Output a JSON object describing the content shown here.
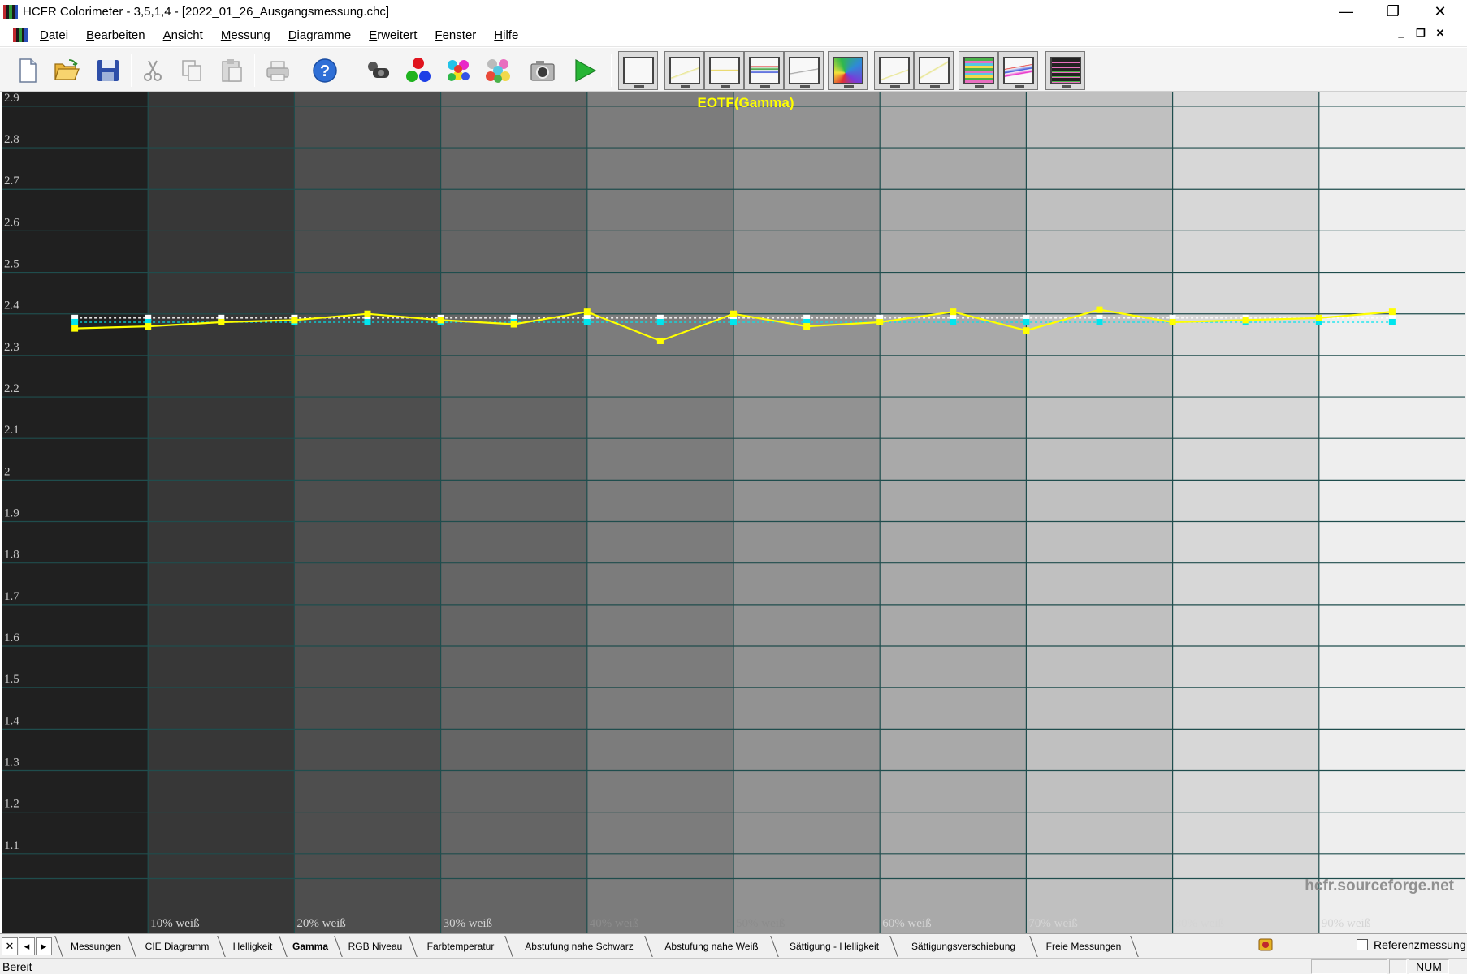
{
  "window": {
    "title": "HCFR Colorimeter - 3,5,1,4 - [2022_01_26_Ausgangsmessung.chc]",
    "minimize_glyph": "—",
    "maximize_glyph": "❐",
    "close_glyph": "✕"
  },
  "menu": {
    "items": [
      "Datei",
      "Bearbeiten",
      "Ansicht",
      "Messung",
      "Diagramme",
      "Erweitert",
      "Fenster",
      "Hilfe"
    ],
    "mdi_minimize": "_",
    "mdi_restore": "❐",
    "mdi_close": "✕"
  },
  "toolbar": {
    "icons": [
      "new-file-icon",
      "open-folder-icon",
      "save-icon",
      "cut-icon",
      "copy-icon",
      "paste-icon",
      "print-icon",
      "help-icon",
      "colorimeter-sensor-icon",
      "rgb-primaries-icon",
      "secondary-colors-icon",
      "all-colors-icon",
      "camera-icon",
      "play-icon"
    ],
    "graph_buttons": [
      "luminance-graph-icon",
      "gamma-graph-icon",
      "rgb-levels-graph-icon",
      "rgb-histogram-graph-icon",
      "color-temp-graph-icon",
      "cie-chart-icon",
      "near-black-graph-icon",
      "near-white-graph-icon",
      "saturation-lum-graph-icon",
      "saturation-shift-graph-icon",
      "measures-list-icon"
    ],
    "colors": {
      "help": "#2f6fd6",
      "play": "#27b535"
    }
  },
  "chart_data": {
    "type": "line",
    "title": "EOTF(Gamma)",
    "watermark": "hcfr.sourceforge.net",
    "ylim": [
      1.0,
      3.0
    ],
    "yticks": [
      "2.9",
      "2.8",
      "2.7",
      "2.6",
      "2.5",
      "2.4",
      "2.3",
      "2.2",
      "2.1",
      "2",
      "1.9",
      "1.8",
      "1.7",
      "1.6",
      "1.5",
      "1.4",
      "1.3",
      "1.2",
      "1.1"
    ],
    "ytick_values": [
      2.9,
      2.8,
      2.7,
      2.6,
      2.5,
      2.4,
      2.3,
      2.2,
      2.1,
      2.0,
      1.9,
      1.8,
      1.7,
      1.6,
      1.5,
      1.4,
      1.3,
      1.2,
      1.1
    ],
    "xlim": [
      0,
      100
    ],
    "xlabels": [
      "10% weiß",
      "20% weiß",
      "30% weiß",
      "40% weiß",
      "50% weiß",
      "60% weiß",
      "70% weiß",
      "80% weiß",
      "90% weiß"
    ],
    "x": [
      5,
      10,
      15,
      20,
      25,
      30,
      35,
      40,
      45,
      50,
      55,
      60,
      65,
      70,
      75,
      80,
      85,
      90,
      95
    ],
    "series": [
      {
        "values": [
          2.365,
          2.37,
          2.38,
          2.385,
          2.4,
          2.385,
          2.375,
          2.405,
          2.335,
          2.4,
          2.37,
          2.38,
          2.405,
          2.36,
          2.41,
          2.38,
          2.385,
          2.39,
          2.405
        ],
        "color": "#ffff00",
        "marker": "#ffff00"
      },
      {
        "values": [
          2.39,
          2.39,
          2.39,
          2.39,
          2.39,
          2.39,
          2.39,
          2.39,
          2.39,
          2.39,
          2.39,
          2.39,
          2.39,
          2.39,
          2.39,
          2.39,
          2.39,
          2.39,
          2.39
        ],
        "color": "#ffffff",
        "marker": "#ffffff",
        "dashed": true
      },
      {
        "values": [
          2.38,
          2.38,
          2.38,
          2.38,
          2.38,
          2.38,
          2.38,
          2.38,
          2.38,
          2.38,
          2.38,
          2.38,
          2.38,
          2.38,
          2.38,
          2.38,
          2.38,
          2.38,
          2.38
        ],
        "color": "#00e5ee",
        "marker": "#00e5ee",
        "dashed": true
      }
    ],
    "grid": true,
    "grid_color": "#1f4d4d",
    "title_color": "#ffff00"
  },
  "tabs": {
    "nav": [
      "✕",
      "◂",
      "▸"
    ],
    "items": [
      "Messungen",
      "CIE Diagramm",
      "Helligkeit",
      "Gamma",
      "RGB Niveau",
      "Farbtemperatur",
      "Abstufung nahe Schwarz",
      "Abstufung nahe Weiß",
      "Sättigung - Helligkeit",
      "Sättigungsverschiebung",
      "Freie Messungen"
    ],
    "active": "Gamma",
    "reference_label": "Referenzmessung"
  },
  "status": {
    "text": "Bereit",
    "num": "NUM"
  }
}
